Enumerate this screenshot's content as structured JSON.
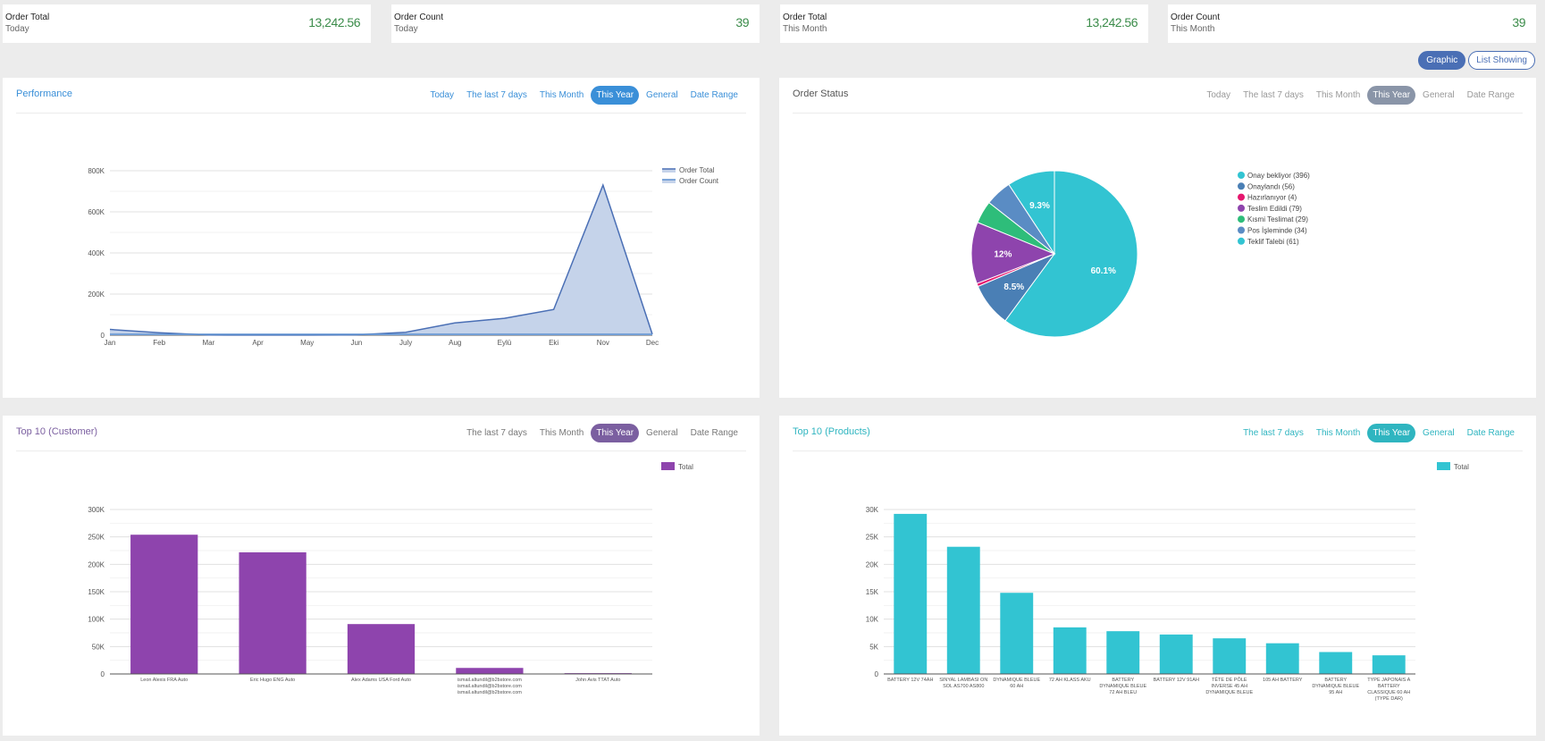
{
  "stats": [
    {
      "label": "Order Total",
      "period": "Today",
      "value": "13,242.56"
    },
    {
      "label": "Order Count",
      "period": "Today",
      "value": "39"
    },
    {
      "label": "Order Total",
      "period": "This Month",
      "value": "13,242.56"
    },
    {
      "label": "Order Count",
      "period": "This Month",
      "value": "39"
    }
  ],
  "view_toggle": {
    "graphic": "Graphic",
    "list": "List Showing",
    "active": "graphic"
  },
  "colors": {
    "performance": "#3a8fd8",
    "status": "#8a95a8",
    "customer": "#7b5fa0",
    "products": "#2fb5c0"
  },
  "panels": {
    "performance": {
      "title": "Performance",
      "tabs": [
        "Today",
        "The last 7 days",
        "This Month",
        "This Year",
        "General",
        "Date Range"
      ],
      "active_tab": "This Year"
    },
    "status": {
      "title": "Order Status",
      "tabs": [
        "Today",
        "The last 7 days",
        "This Month",
        "This Year",
        "General",
        "Date Range"
      ],
      "active_tab": "This Year"
    },
    "customer": {
      "title": "Top 10 (Customer)",
      "tabs": [
        "The last 7 days",
        "This Month",
        "This Year",
        "General",
        "Date Range"
      ],
      "active_tab": "This Year"
    },
    "products": {
      "title": "Top 10 (Products)",
      "tabs": [
        "The last 7 days",
        "This Month",
        "This Year",
        "General",
        "Date Range"
      ],
      "active_tab": "This Year"
    }
  },
  "chart_data": [
    {
      "id": "performance",
      "type": "area",
      "title": "",
      "x": [
        "Jan",
        "Feb",
        "Mar",
        "Apr",
        "May",
        "Jun",
        "July",
        "Aug",
        "Eylü",
        "Eki",
        "Nov",
        "Dec"
      ],
      "series": [
        {
          "name": "Order Total",
          "color": "#4a6fb5",
          "values": [
            28000,
            12000,
            1000,
            500,
            500,
            1500,
            14000,
            60000,
            82000,
            125000,
            730000,
            5000
          ]
        },
        {
          "name": "Order Count",
          "color": "#5b8fd0",
          "values": [
            39,
            20,
            5,
            2,
            2,
            5,
            20,
            40,
            60,
            80,
            396,
            39
          ]
        }
      ],
      "ylim": [
        0,
        800000
      ],
      "yticks": [
        0,
        200000,
        400000,
        600000,
        800000
      ],
      "ytick_labels": [
        "0",
        "200K",
        "400K",
        "600K",
        "800K"
      ],
      "grid": true,
      "legend": "top-right"
    },
    {
      "id": "status",
      "type": "pie",
      "slices": [
        {
          "label": "Onay bekliyor (396)",
          "value": 396,
          "color": "#32c4d2",
          "pct_label": "60.1%"
        },
        {
          "label": "Onaylandı (56)",
          "value": 56,
          "color": "#4a7fb5",
          "pct_label": "8.5%"
        },
        {
          "label": "Hazırlanıyor (4)",
          "value": 4,
          "color": "#e5176e",
          "pct_label": ""
        },
        {
          "label": "Teslim Edildi (79)",
          "value": 79,
          "color": "#8e44ad",
          "pct_label": "12%"
        },
        {
          "label": "Kısmi Teslimat (29)",
          "value": 29,
          "color": "#2ebd7a",
          "pct_label": ""
        },
        {
          "label": "Pos İşleminde (34)",
          "value": 34,
          "color": "#5a8cc4",
          "pct_label": ""
        },
        {
          "label": "Teklif Talebi (61)",
          "value": 61,
          "color": "#32c4d2",
          "pct_label": "9.3%"
        }
      ],
      "legend": "right"
    },
    {
      "id": "customer",
      "type": "bar",
      "categories": [
        "Leon Alexis FRA Auto",
        "Eric Hugo ENG Auto",
        "Alex Adams USA Ford Auto",
        "ismail.altundil@b2bstore.com\nismail.altundil@b2bstore.com\nismail.altundil@b2bstore.com",
        "John Avis TTAT Auto"
      ],
      "series": [
        {
          "name": "Total",
          "color": "#8e44ad",
          "values": [
            254000,
            222000,
            91000,
            11000,
            1500
          ]
        }
      ],
      "ylim": [
        0,
        300000
      ],
      "yticks": [
        0,
        50000,
        100000,
        150000,
        200000,
        250000,
        300000
      ],
      "ytick_labels": [
        "0",
        "50K",
        "100K",
        "150K",
        "200K",
        "250K",
        "300K"
      ],
      "grid": true,
      "legend": "top-right"
    },
    {
      "id": "products",
      "type": "bar",
      "categories": [
        "BATTERY 12V 74AH",
        "SINYAL LAMBASI ON\nSOL AS700 AS800",
        "DYNAMIQUE BLEUE\n60 AH",
        "72 AH KLASS AKU",
        "BATTERY\nDYNAMIQUE BLEUE\n72 AH BLEU",
        "BATTERY 12V 91AH",
        "TÊTE DE PÔLE\nINVERSE 45 AH\nDYNAMIQUE BLEUE",
        "105 AH BATTERY",
        "BATTERY\nDYNAMIQUE BLEUE\n95 AH",
        "TYPE JAPONAIS A\nBATTERY\nCLASSIQUE 60 AH\n(TYPE DAR)"
      ],
      "series": [
        {
          "name": "Total",
          "color": "#32c4d2",
          "values": [
            29200,
            23200,
            14800,
            8500,
            7800,
            7200,
            6500,
            5600,
            4000,
            3400
          ]
        }
      ],
      "ylim": [
        0,
        30000
      ],
      "yticks": [
        0,
        5000,
        10000,
        15000,
        20000,
        25000,
        30000
      ],
      "ytick_labels": [
        "0",
        "5K",
        "10K",
        "15K",
        "20K",
        "25K",
        "30K"
      ],
      "grid": true,
      "legend": "top-right"
    }
  ]
}
